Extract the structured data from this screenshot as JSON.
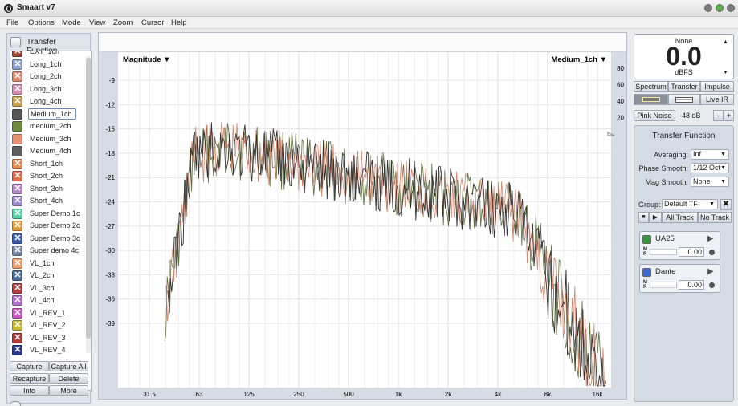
{
  "window": {
    "title": "Smaart v7"
  },
  "menu": [
    "File",
    "Options",
    "Mode",
    "View",
    "Zoom",
    "Cursor",
    "Help"
  ],
  "left": {
    "tf_button": "Transfer Function",
    "items": [
      {
        "label": "EXT_1ch",
        "color": "#a04a3a",
        "x": true
      },
      {
        "label": "Long_1ch",
        "color": "#8aa0c8",
        "x": true
      },
      {
        "label": "Long_2ch",
        "color": "#d8896e",
        "x": true
      },
      {
        "label": "Long_3ch",
        "color": "#d28db4",
        "x": true
      },
      {
        "label": "Long_4ch",
        "color": "#c9a04f",
        "x": true
      },
      {
        "label": "Medium_1ch",
        "color": "#555555",
        "x": false,
        "selected": true
      },
      {
        "label": "medium_2ch",
        "color": "#6f8a3e",
        "x": false
      },
      {
        "label": "Medium_3ch",
        "color": "#e39276",
        "x": false
      },
      {
        "label": "Medium_4ch",
        "color": "#5e5e5e",
        "x": false
      },
      {
        "label": "Short_1ch",
        "color": "#e38a55",
        "x": true
      },
      {
        "label": "Short_2ch",
        "color": "#e06a4a",
        "x": true
      },
      {
        "label": "Short_3ch",
        "color": "#b58ac8",
        "x": true
      },
      {
        "label": "Short_4ch",
        "color": "#9a8ad0",
        "x": true
      },
      {
        "label": "Super Demo 1c",
        "color": "#5ad0a8",
        "x": true
      },
      {
        "label": "Super Demo 2c",
        "color": "#e0a040",
        "x": true
      },
      {
        "label": "Super Demo 3c",
        "color": "#3a5aa8",
        "x": true
      },
      {
        "label": "Super demo 4c",
        "color": "#7a86a8",
        "x": true
      },
      {
        "label": "VL_1ch",
        "color": "#e89a6a",
        "x": true
      },
      {
        "label": "VL_2ch",
        "color": "#4a6a98",
        "x": true
      },
      {
        "label": "VL_3ch",
        "color": "#b04040",
        "x": true
      },
      {
        "label": "VL_4ch",
        "color": "#b070c8",
        "x": true
      },
      {
        "label": "VL_REV_1",
        "color": "#c85ac0",
        "x": true
      },
      {
        "label": "VL_REV_2",
        "color": "#c8b83a",
        "x": true
      },
      {
        "label": "VL_REV_3",
        "color": "#b03a3a",
        "x": true
      },
      {
        "label": "VL_REV_4",
        "color": "#2a3a88",
        "x": true
      }
    ],
    "buttons": {
      "capture": "Capture",
      "capture_all": "Capture All",
      "recapture": "Recapture",
      "delete": "Delete",
      "info": "Info",
      "more": "More"
    }
  },
  "graph": {
    "left_title": "Magnitude ▼",
    "right_title": "Medium_1ch ▼",
    "y_ticks": [
      "-9",
      "-12",
      "-15",
      "-18",
      "-21",
      "-24",
      "-27",
      "-30",
      "-33",
      "-36",
      "-39"
    ],
    "y_right_ticks": [
      "80",
      "60",
      "40",
      "20"
    ],
    "x_ticks": [
      "31.5",
      "63",
      "125",
      "250",
      "500",
      "1k",
      "2k",
      "4k",
      "8k",
      "16k"
    ]
  },
  "right": {
    "meter": {
      "label": "None",
      "value": "0.0",
      "unit": "dBFS"
    },
    "tabs": {
      "spectrum": "Spectrum",
      "transfer": "Transfer",
      "impulse": "Impulse"
    },
    "live_ir": "Live IR",
    "pink_noise": "Pink Noise",
    "noise_level": "-48 dB",
    "minus": "-",
    "plus": "+",
    "tf_title": "Transfer Function",
    "averaging_label": "Averaging:",
    "averaging_value": "Inf",
    "phase_label": "Phase Smooth:",
    "phase_value": "1/12 Oct",
    "mag_label": "Mag Smooth:",
    "mag_value": "None",
    "group_label": "Group:",
    "group_value": "Default TF",
    "all_track": "All Track",
    "no_track": "No Track",
    "channels": [
      {
        "name": "UA25",
        "value": "0.00",
        "color": "#2f9a3a"
      },
      {
        "name": "Dante",
        "value": "0.00",
        "color": "#3a6ad8"
      }
    ],
    "mr_m": "M",
    "mr_r": "R"
  }
}
